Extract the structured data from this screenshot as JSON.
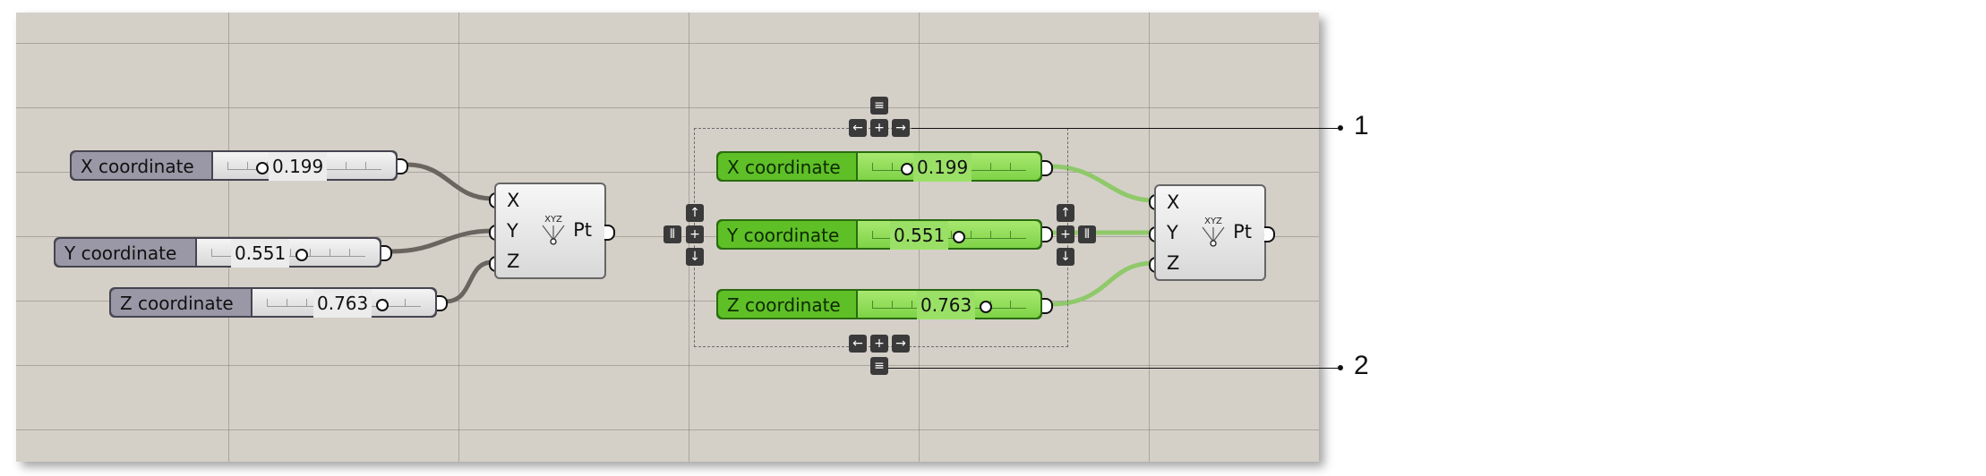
{
  "left_group": {
    "sliders": [
      {
        "label": "X coordinate",
        "value": "0.199"
      },
      {
        "label": "Y coordinate",
        "value": "0.551"
      },
      {
        "label": "Z coordinate",
        "value": "0.763"
      }
    ],
    "component": {
      "inputs": [
        "X",
        "Y",
        "Z"
      ],
      "output": "Pt",
      "icon": "construct-point-icon",
      "icon_text": "XYZ"
    }
  },
  "right_group": {
    "sliders": [
      {
        "label": "X coordinate",
        "value": "0.199"
      },
      {
        "label": "Y coordinate",
        "value": "0.551"
      },
      {
        "label": "Z coordinate",
        "value": "0.763"
      }
    ],
    "component": {
      "inputs": [
        "X",
        "Y",
        "Z"
      ],
      "output": "Pt",
      "icon": "construct-point-icon",
      "icon_text": "XYZ"
    },
    "accent": "#6fc83a"
  },
  "callouts": [
    "1",
    "2"
  ],
  "colors": {
    "canvas": "#d4d0c8",
    "grey_wire": "#6b6560",
    "green_wire": "#8fc96a",
    "green_slider": "#7ed347"
  }
}
